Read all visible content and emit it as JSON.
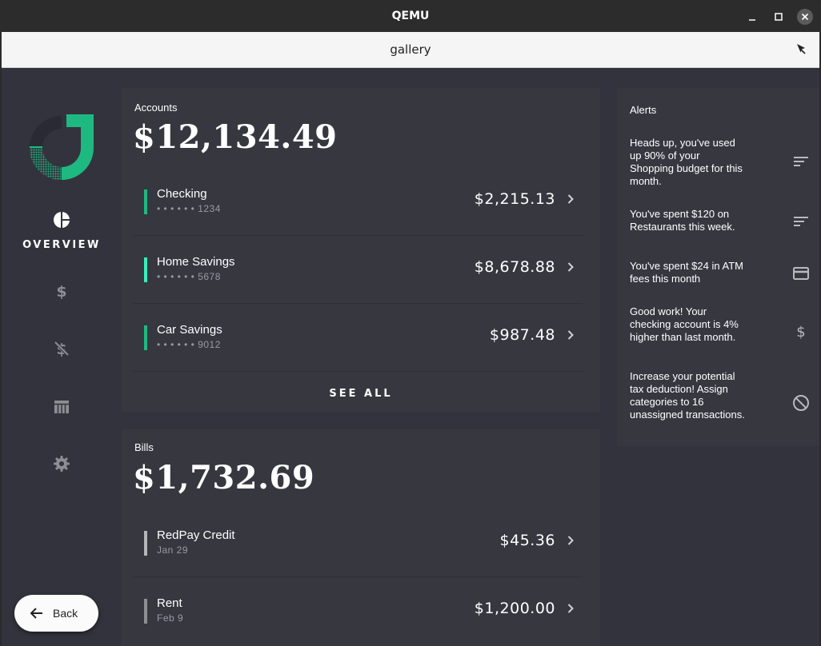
{
  "window": {
    "title": "QEMU"
  },
  "appbar": {
    "title": "gallery"
  },
  "nav": {
    "overview_label": "OVERVIEW"
  },
  "accounts": {
    "label": "Accounts",
    "total": "$12,134.49",
    "items": [
      {
        "name": "Checking",
        "number": "• • • • • • 1234",
        "amount": "$2,215.13",
        "color": "#1eb980"
      },
      {
        "name": "Home Savings",
        "number": "• • • • • • 5678",
        "amount": "$8,678.88",
        "color": "#37efba"
      },
      {
        "name": "Car Savings",
        "number": "• • • • • • 9012",
        "amount": "$987.48",
        "color": "#1eb980"
      }
    ],
    "see_all": "SEE ALL"
  },
  "bills": {
    "label": "Bills",
    "total": "$1,732.69",
    "items": [
      {
        "name": "RedPay Credit",
        "date": "Jan 29",
        "amount": "$45.36",
        "color": "#b5b5b9"
      },
      {
        "name": "Rent",
        "date": "Feb 9",
        "amount": "$1,200.00",
        "color": "#8d8d93"
      }
    ]
  },
  "alerts": {
    "title": "Alerts",
    "items": [
      {
        "text": "Heads up, you've used up 90% of your Shopping budget for this month.",
        "icon": "sort-icon"
      },
      {
        "text": "You've spent $120 on Restaurants this week.",
        "icon": "sort-icon"
      },
      {
        "text": "You've spent $24 in ATM fees this month",
        "icon": "credit-card-icon"
      },
      {
        "text": "Good work! Your checking account is 4% higher than last month.",
        "icon": "dollar-icon"
      },
      {
        "text": "Increase your potential tax deduction! Assign categories to 16 unassigned transactions.",
        "icon": "not-interested-icon"
      }
    ]
  },
  "back_button": {
    "label": "Back"
  },
  "colors": {
    "background": "#33333d",
    "card": "#373740",
    "accent": "#1eb980"
  }
}
